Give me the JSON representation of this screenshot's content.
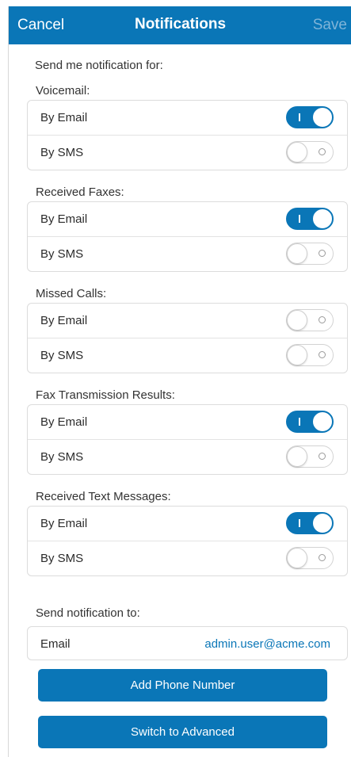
{
  "nav": {
    "cancel": "Cancel",
    "title": "Notifications",
    "save": "Save"
  },
  "intro": "Send me notification for:",
  "sections": [
    {
      "label": "Voicemail:",
      "rows": [
        {
          "label": "By Email",
          "enabled": true
        },
        {
          "label": "By SMS",
          "enabled": false
        }
      ]
    },
    {
      "label": "Received Faxes:",
      "rows": [
        {
          "label": "By Email",
          "enabled": true
        },
        {
          "label": "By SMS",
          "enabled": false
        }
      ]
    },
    {
      "label": "Missed Calls:",
      "rows": [
        {
          "label": "By Email",
          "enabled": false
        },
        {
          "label": "By SMS",
          "enabled": false
        }
      ]
    },
    {
      "label": "Fax Transmission Results:",
      "rows": [
        {
          "label": "By Email",
          "enabled": true
        },
        {
          "label": "By SMS",
          "enabled": false
        }
      ]
    },
    {
      "label": "Received Text Messages:",
      "rows": [
        {
          "label": "By Email",
          "enabled": true
        },
        {
          "label": "By SMS",
          "enabled": false
        }
      ]
    }
  ],
  "send_to": {
    "label": "Send notification to:",
    "email_label": "Email",
    "email_value": "admin.user@acme.com"
  },
  "buttons": {
    "add_phone": "Add Phone Number",
    "switch_advanced": "Switch to Advanced"
  },
  "colors": {
    "accent": "#0a76b7",
    "save_disabled": "#7fb4d8"
  }
}
